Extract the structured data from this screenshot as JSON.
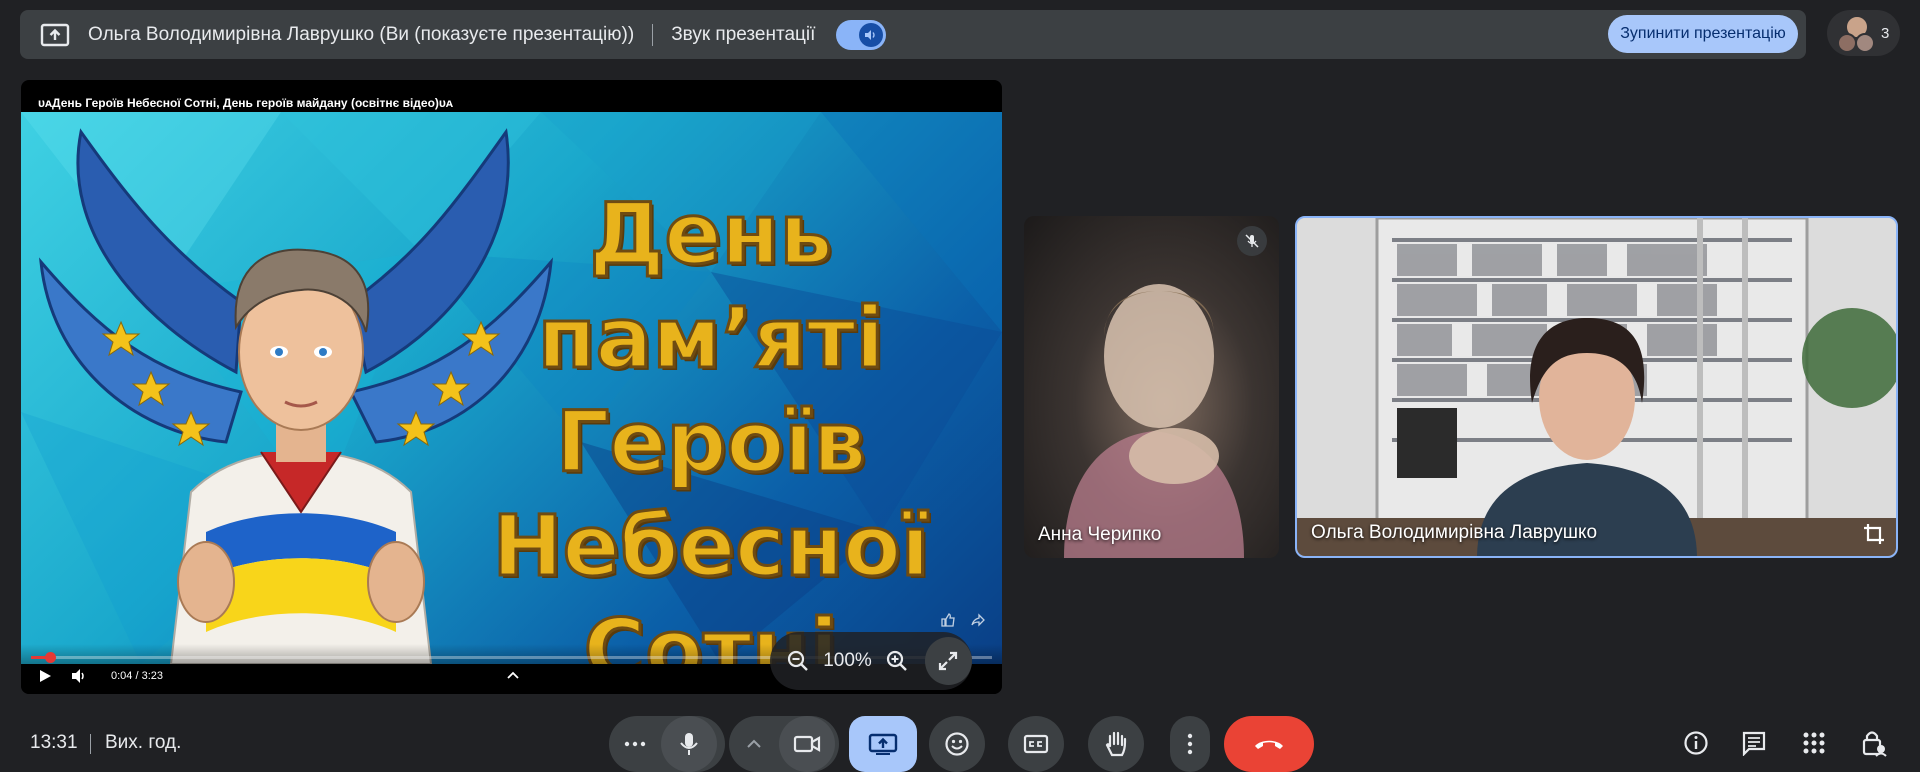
{
  "topbar": {
    "presenter_text": "Ольга Володимирівна Лаврушко (Ви (показуєте презентацію))",
    "sound_label": "Звук презентації",
    "stop_button": "Зупинити презентацію",
    "people_count": "3",
    "icons": [
      "present-to-all-icon",
      "volume-icon"
    ]
  },
  "presentation": {
    "video_title": "ᴜᴀДень Героїв Небесної Сотні, День героїв майдану (освітнє відео)ᴜᴀ",
    "slide_heading": "День пам’яті\nГероїв\nНебесної\nСотні",
    "player": {
      "time": "0:04 / 3:23",
      "progress": 0.02
    },
    "zoom": {
      "level": "100%"
    }
  },
  "participants": [
    {
      "name": "Анна Черипко",
      "muted": true
    },
    {
      "name": "Ольга Володимирівна Лаврушко",
      "muted": false
    }
  ],
  "bottombar": {
    "clock": "13:31",
    "label": "Вих. год."
  },
  "colors": {
    "background": "#202124",
    "accent": "#a8c7fa",
    "leave": "#ea4335",
    "slide_text": "#e8b31c"
  }
}
